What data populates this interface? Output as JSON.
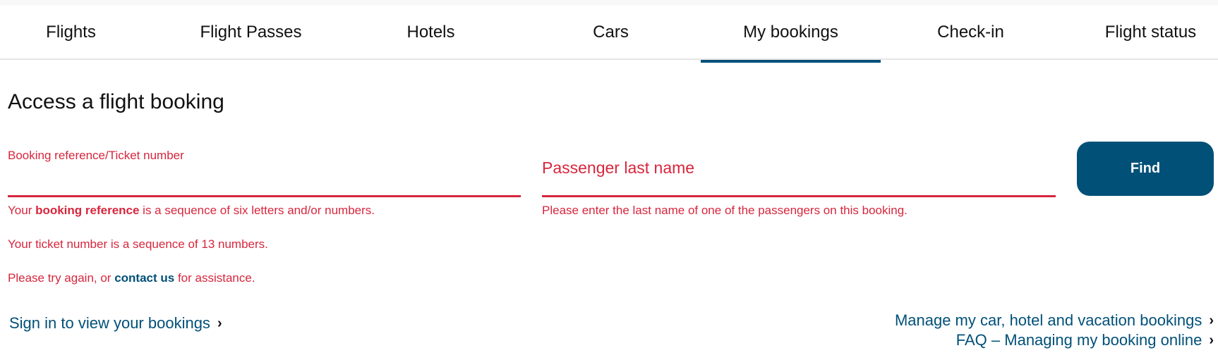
{
  "nav": {
    "tabs": [
      {
        "label": "Flights",
        "active": false
      },
      {
        "label": "Flight Passes",
        "active": false
      },
      {
        "label": "Hotels",
        "active": false
      },
      {
        "label": "Cars",
        "active": false
      },
      {
        "label": "My bookings",
        "active": true
      },
      {
        "label": "Check-in",
        "active": false
      },
      {
        "label": "Flight status",
        "active": false
      }
    ]
  },
  "form": {
    "title": "Access a flight booking",
    "booking_ref": {
      "label": "Booking reference/Ticket number",
      "value": "",
      "error_line1_pre": "Your ",
      "error_line1_bold": "booking reference",
      "error_line1_post": " is a sequence of six letters and/or numbers.",
      "error_line2": "Your ticket number is a sequence of 13 numbers.",
      "error_line3_pre": "Please try again, or ",
      "error_line3_link": "contact us",
      "error_line3_post": " for assistance."
    },
    "last_name": {
      "placeholder": "Passenger last name",
      "value": "",
      "error": "Please enter the last name of one of the passengers on this booking."
    },
    "find_label": "Find"
  },
  "links": {
    "sign_in": "Sign in to view your bookings",
    "manage_other": "Manage my car, hotel and vacation bookings",
    "faq": "FAQ – Managing my booking online",
    "chevron": "›"
  },
  "colors": {
    "brand": "#005078",
    "error": "#d7263d"
  }
}
